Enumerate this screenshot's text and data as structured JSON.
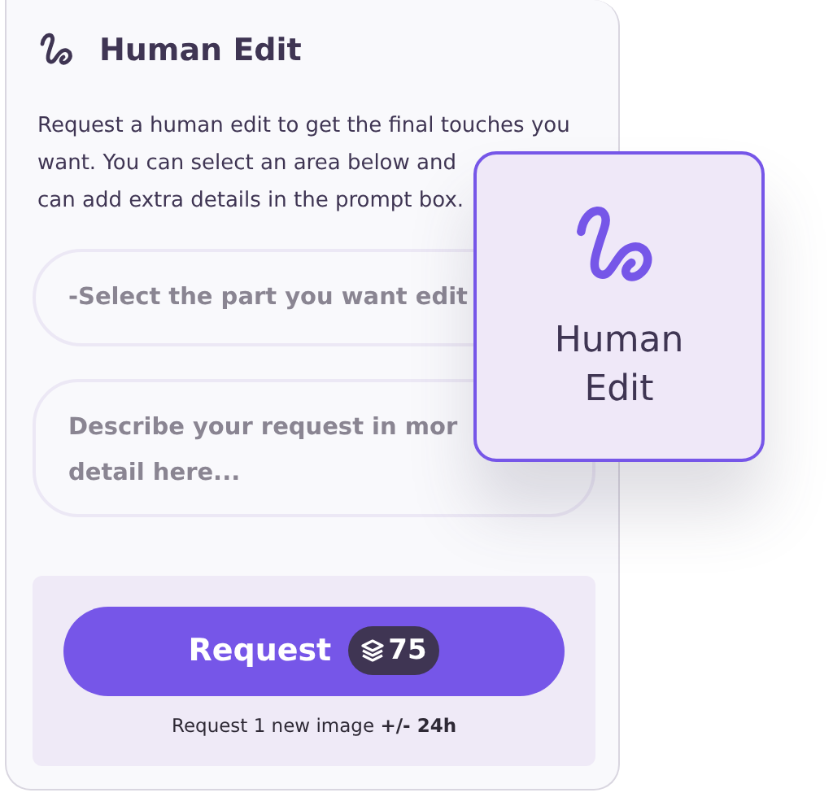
{
  "panel": {
    "title": "Human Edit",
    "description_lines": [
      "Request a human edit to get the final touches you",
      "want. You can select an area below and",
      "can add extra details in the prompt box."
    ],
    "fields": [
      {
        "kind": "select",
        "placeholder": "-Select the part you want edit"
      },
      {
        "kind": "textarea",
        "placeholder": "Describe your request in mor\ndetail here..."
      }
    ],
    "request_button": {
      "label": "Request",
      "credits": "75"
    },
    "note": "Request 1 new image **+/- 24h**"
  },
  "overlay_card": {
    "label": "Human\nEdit"
  }
}
